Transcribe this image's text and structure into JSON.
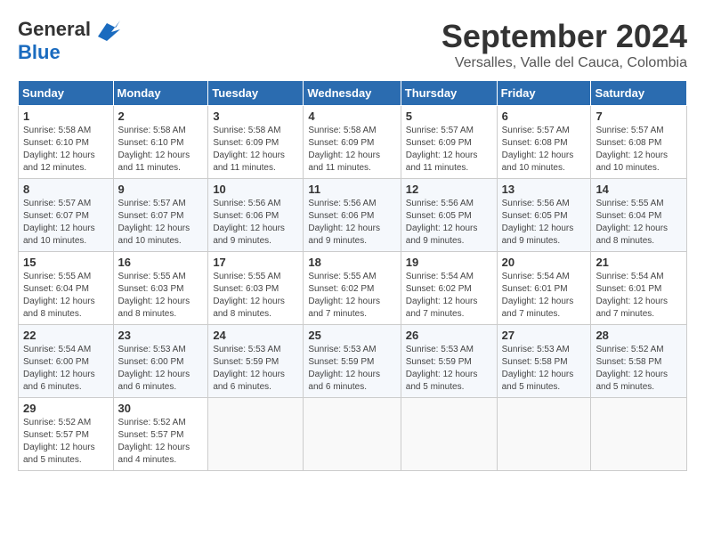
{
  "header": {
    "logo": {
      "general": "General",
      "blue": "Blue"
    },
    "title": "September 2024",
    "location": "Versalles, Valle del Cauca, Colombia"
  },
  "weekdays": [
    "Sunday",
    "Monday",
    "Tuesday",
    "Wednesday",
    "Thursday",
    "Friday",
    "Saturday"
  ],
  "weeks": [
    [
      {
        "day": 1,
        "sunrise": "5:58 AM",
        "sunset": "6:10 PM",
        "daylight": "12 hours and 12 minutes."
      },
      {
        "day": 2,
        "sunrise": "5:58 AM",
        "sunset": "6:10 PM",
        "daylight": "12 hours and 11 minutes."
      },
      {
        "day": 3,
        "sunrise": "5:58 AM",
        "sunset": "6:09 PM",
        "daylight": "12 hours and 11 minutes."
      },
      {
        "day": 4,
        "sunrise": "5:58 AM",
        "sunset": "6:09 PM",
        "daylight": "12 hours and 11 minutes."
      },
      {
        "day": 5,
        "sunrise": "5:57 AM",
        "sunset": "6:09 PM",
        "daylight": "12 hours and 11 minutes."
      },
      {
        "day": 6,
        "sunrise": "5:57 AM",
        "sunset": "6:08 PM",
        "daylight": "12 hours and 10 minutes."
      },
      {
        "day": 7,
        "sunrise": "5:57 AM",
        "sunset": "6:08 PM",
        "daylight": "12 hours and 10 minutes."
      }
    ],
    [
      {
        "day": 8,
        "sunrise": "5:57 AM",
        "sunset": "6:07 PM",
        "daylight": "12 hours and 10 minutes."
      },
      {
        "day": 9,
        "sunrise": "5:57 AM",
        "sunset": "6:07 PM",
        "daylight": "12 hours and 10 minutes."
      },
      {
        "day": 10,
        "sunrise": "5:56 AM",
        "sunset": "6:06 PM",
        "daylight": "12 hours and 9 minutes."
      },
      {
        "day": 11,
        "sunrise": "5:56 AM",
        "sunset": "6:06 PM",
        "daylight": "12 hours and 9 minutes."
      },
      {
        "day": 12,
        "sunrise": "5:56 AM",
        "sunset": "6:05 PM",
        "daylight": "12 hours and 9 minutes."
      },
      {
        "day": 13,
        "sunrise": "5:56 AM",
        "sunset": "6:05 PM",
        "daylight": "12 hours and 9 minutes."
      },
      {
        "day": 14,
        "sunrise": "5:55 AM",
        "sunset": "6:04 PM",
        "daylight": "12 hours and 8 minutes."
      }
    ],
    [
      {
        "day": 15,
        "sunrise": "5:55 AM",
        "sunset": "6:04 PM",
        "daylight": "12 hours and 8 minutes."
      },
      {
        "day": 16,
        "sunrise": "5:55 AM",
        "sunset": "6:03 PM",
        "daylight": "12 hours and 8 minutes."
      },
      {
        "day": 17,
        "sunrise": "5:55 AM",
        "sunset": "6:03 PM",
        "daylight": "12 hours and 8 minutes."
      },
      {
        "day": 18,
        "sunrise": "5:55 AM",
        "sunset": "6:02 PM",
        "daylight": "12 hours and 7 minutes."
      },
      {
        "day": 19,
        "sunrise": "5:54 AM",
        "sunset": "6:02 PM",
        "daylight": "12 hours and 7 minutes."
      },
      {
        "day": 20,
        "sunrise": "5:54 AM",
        "sunset": "6:01 PM",
        "daylight": "12 hours and 7 minutes."
      },
      {
        "day": 21,
        "sunrise": "5:54 AM",
        "sunset": "6:01 PM",
        "daylight": "12 hours and 7 minutes."
      }
    ],
    [
      {
        "day": 22,
        "sunrise": "5:54 AM",
        "sunset": "6:00 PM",
        "daylight": "12 hours and 6 minutes."
      },
      {
        "day": 23,
        "sunrise": "5:53 AM",
        "sunset": "6:00 PM",
        "daylight": "12 hours and 6 minutes."
      },
      {
        "day": 24,
        "sunrise": "5:53 AM",
        "sunset": "5:59 PM",
        "daylight": "12 hours and 6 minutes."
      },
      {
        "day": 25,
        "sunrise": "5:53 AM",
        "sunset": "5:59 PM",
        "daylight": "12 hours and 6 minutes."
      },
      {
        "day": 26,
        "sunrise": "5:53 AM",
        "sunset": "5:59 PM",
        "daylight": "12 hours and 5 minutes."
      },
      {
        "day": 27,
        "sunrise": "5:53 AM",
        "sunset": "5:58 PM",
        "daylight": "12 hours and 5 minutes."
      },
      {
        "day": 28,
        "sunrise": "5:52 AM",
        "sunset": "5:58 PM",
        "daylight": "12 hours and 5 minutes."
      }
    ],
    [
      {
        "day": 29,
        "sunrise": "5:52 AM",
        "sunset": "5:57 PM",
        "daylight": "12 hours and 5 minutes."
      },
      {
        "day": 30,
        "sunrise": "5:52 AM",
        "sunset": "5:57 PM",
        "daylight": "12 hours and 4 minutes."
      },
      null,
      null,
      null,
      null,
      null
    ]
  ]
}
